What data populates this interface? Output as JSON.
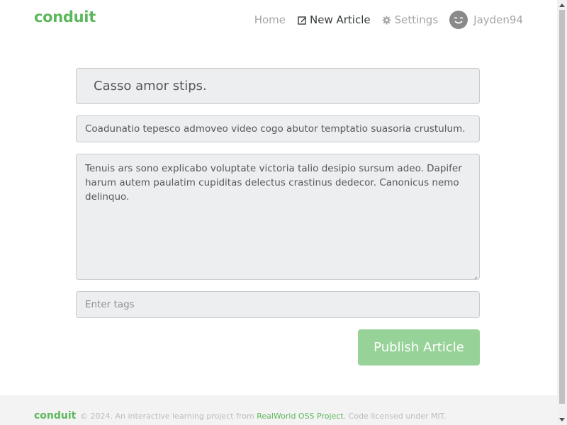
{
  "brand": "conduit",
  "nav": {
    "home": "Home",
    "new_article": "New Article",
    "settings": "Settings",
    "username": "Jayden94"
  },
  "icons": {
    "new_article": "edit-icon",
    "settings": "gear-icon",
    "avatar": "smiley-avatar"
  },
  "editor": {
    "title_value": "Casso amor stips.",
    "about_value": "Coadunatio tepesco admoveo video cogo abutor temptatio suasoria crustulum.",
    "body_value": "Tenuis ars sono explicabo voluptate victoria talio desipio sursum adeo. Dapifer harum autem paulatim cupiditas delectus crastinus dedecor. Canonicus nemo delinquo.",
    "tags_placeholder": "Enter tags",
    "publish_label": "Publish Article"
  },
  "footer": {
    "brand": "conduit",
    "text_before": "© 2024. An interactive learning project from",
    "link": "RealWorld OSS Project",
    "text_after": ". Code licensed under MIT."
  },
  "colors": {
    "brand": "#5cb85c",
    "publish_button": "#97d398",
    "field_background": "#eceeef"
  }
}
